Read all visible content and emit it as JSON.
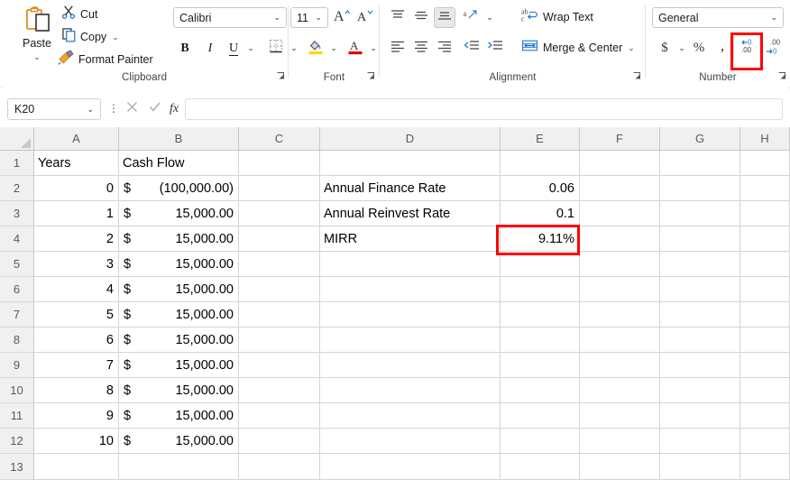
{
  "ribbon": {
    "groups": [
      {
        "name": "Clipboard",
        "label": "Clipboard"
      },
      {
        "name": "Font",
        "label": "Font"
      },
      {
        "name": "Alignment",
        "label": "Alignment"
      },
      {
        "name": "Number",
        "label": "Number"
      }
    ],
    "clipboard": {
      "paste_label": "Paste",
      "cut_label": "Cut",
      "copy_label": "Copy",
      "format_painter_label": "Format Painter",
      "paste_icon": "clipboard-icon",
      "cut_icon": "scissors-icon",
      "copy_icon": "copy-icon",
      "format_painter_icon": "paintbrush-icon"
    },
    "font": {
      "font_name": "Calibri",
      "font_size": "11",
      "grow_font_icon": "increase-font-size-icon",
      "shrink_font_icon": "decrease-font-size-icon",
      "bold_label": "B",
      "italic_label": "I",
      "underline_label": "U",
      "borders_icon": "borders-icon",
      "fill_color_icon": "fill-color-icon",
      "font_color_icon": "font-color-icon",
      "fill_color": "#ffd800",
      "font_color": "#e00000"
    },
    "alignment": {
      "top_align_icon": "align-top-icon",
      "middle_align_icon": "align-middle-icon",
      "bottom_align_icon": "align-bottom-icon",
      "orientation_icon": "text-orientation-icon",
      "align_left_icon": "align-left-icon",
      "align_center_icon": "align-center-icon",
      "align_right_icon": "align-right-icon",
      "decrease_indent_icon": "decrease-indent-icon",
      "increase_indent_icon": "increase-indent-icon",
      "wrap_text_label": "Wrap Text",
      "wrap_text_icon": "wrap-text-icon",
      "merge_center_label": "Merge & Center",
      "merge_center_icon": "merge-cells-icon"
    },
    "number": {
      "format_value": "General",
      "accounting_icon": "currency-icon",
      "percent_icon": "percent-style-icon",
      "comma_icon": "comma-style-icon",
      "increase_decimal_icon": "increase-decimal-icon",
      "decrease_decimal_icon": "decrease-decimal-icon",
      "highlight_color": "#ff0000"
    }
  },
  "formula_bar": {
    "name_box_value": "K20",
    "formula_value": "",
    "cancel_icon": "cancel-icon",
    "enter_icon": "enter-icon",
    "function_icon": "insert-function-icon",
    "more_options_icon": "more-options-icon"
  },
  "sheet": {
    "columns": [
      "A",
      "B",
      "C",
      "D",
      "E",
      "F",
      "G",
      "H"
    ],
    "rows": [
      "1",
      "2",
      "3",
      "4",
      "5",
      "6",
      "7",
      "8",
      "9",
      "10",
      "11",
      "12",
      "13"
    ],
    "cells": {
      "A1": "Years",
      "B1": "Cash Flow",
      "A2": "0",
      "B2_sym": "$",
      "B2_num": "(100,000.00)",
      "A3": "1",
      "B3_sym": "$",
      "B3_num": "15,000.00",
      "A4": "2",
      "B4_sym": "$",
      "B4_num": "15,000.00",
      "A5": "3",
      "B5_sym": "$",
      "B5_num": "15,000.00",
      "A6": "4",
      "B6_sym": "$",
      "B6_num": "15,000.00",
      "A7": "5",
      "B7_sym": "$",
      "B7_num": "15,000.00",
      "A8": "6",
      "B8_sym": "$",
      "B8_num": "15,000.00",
      "A9": "7",
      "B9_sym": "$",
      "B9_num": "15,000.00",
      "A10": "8",
      "B10_sym": "$",
      "B10_num": "15,000.00",
      "A11": "9",
      "B11_sym": "$",
      "B11_num": "15,000.00",
      "A12": "10",
      "B12_sym": "$",
      "B12_num": "15,000.00",
      "D2": "Annual Finance Rate",
      "E2": "0.06",
      "D3": "Annual Reinvest Rate",
      "E3": "0.1",
      "D4": "MIRR",
      "E4": "9.11%"
    },
    "highlighted_cell": "E4",
    "highlight_color": "#ff0000"
  }
}
